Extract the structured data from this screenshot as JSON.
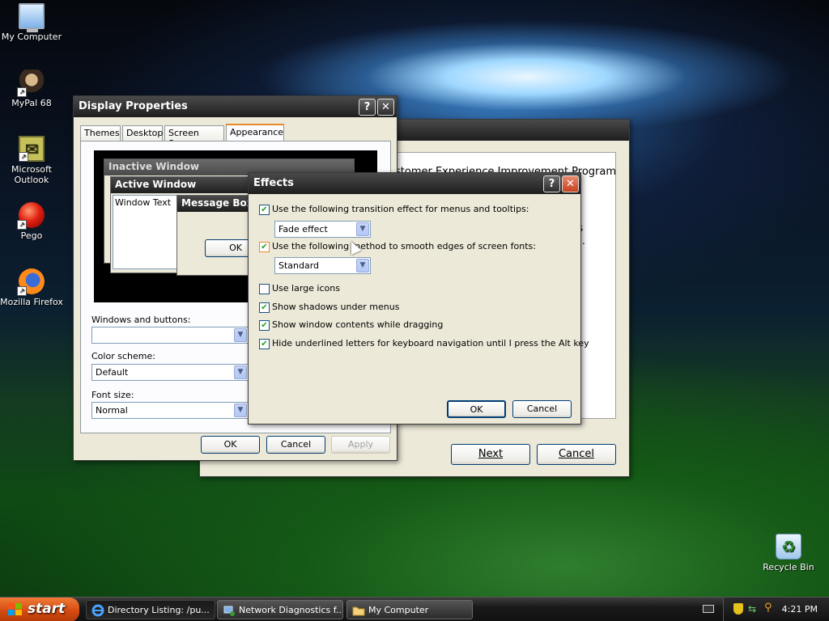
{
  "desktop": {
    "icons": [
      {
        "label": "My Computer",
        "icon": "computer-icon"
      },
      {
        "label": "MyPal 68",
        "icon": "mypal-icon"
      },
      {
        "label": "Microsoft Outlook",
        "icon": "outlook-icon"
      },
      {
        "label": "Pego",
        "icon": "pego-icon"
      },
      {
        "label": "Mozilla Firefox",
        "icon": "firefox-icon"
      },
      {
        "label": "Recycle Bin",
        "icon": "recycle-bin-icon"
      }
    ]
  },
  "wizard": {
    "text_line1": "stomer Experience Improvement Program?",
    "text_frag_a": "ce",
    "text_frag_b": "ws",
    "text_frag_c": "ou.",
    "next_label": "Next",
    "cancel_label": "Cancel"
  },
  "display": {
    "title": "Display Properties",
    "help_label": "?",
    "close_label": "✕",
    "tabs": [
      "Themes",
      "Desktop",
      "Screen Saver",
      "Appearance"
    ],
    "preview": {
      "inactive": "Inactive Window",
      "active": "Active Window",
      "window_text": "Window Text",
      "message_box": "Message Box",
      "ok": "OK"
    },
    "windows_buttons_label": "Windows and buttons:",
    "windows_buttons_value": "",
    "color_scheme_label": "Color scheme:",
    "color_scheme_value": "Default",
    "font_size_label": "Font size:",
    "font_size_value": "Normal",
    "ok_label": "OK",
    "cancel_label": "Cancel",
    "apply_label": "Apply"
  },
  "effects": {
    "title": "Effects",
    "help_label": "?",
    "close_label": "✕",
    "transition_label": "Use the following transition effect for menus and tooltips:",
    "transition_value": "Fade effect",
    "smooth_label": "Use the following method to smooth edges of screen fonts:",
    "smooth_value": "Standard",
    "large_icons_label": "Use large icons",
    "shadows_label": "Show shadows under menus",
    "drag_label": "Show window contents while dragging",
    "underline_label": "Hide underlined letters for keyboard navigation until I press the Alt key",
    "ok_label": "OK",
    "cancel_label": "Cancel"
  },
  "taskbar": {
    "start_label": "start",
    "tasks": [
      {
        "label": "Directory Listing: /pu...",
        "icon": "internet-explorer-icon"
      },
      {
        "label": "Network Diagnostics f...",
        "icon": "network-diagnostics-icon"
      },
      {
        "label": "My Computer",
        "icon": "folder-icon"
      }
    ],
    "clock": "4:21 PM"
  }
}
